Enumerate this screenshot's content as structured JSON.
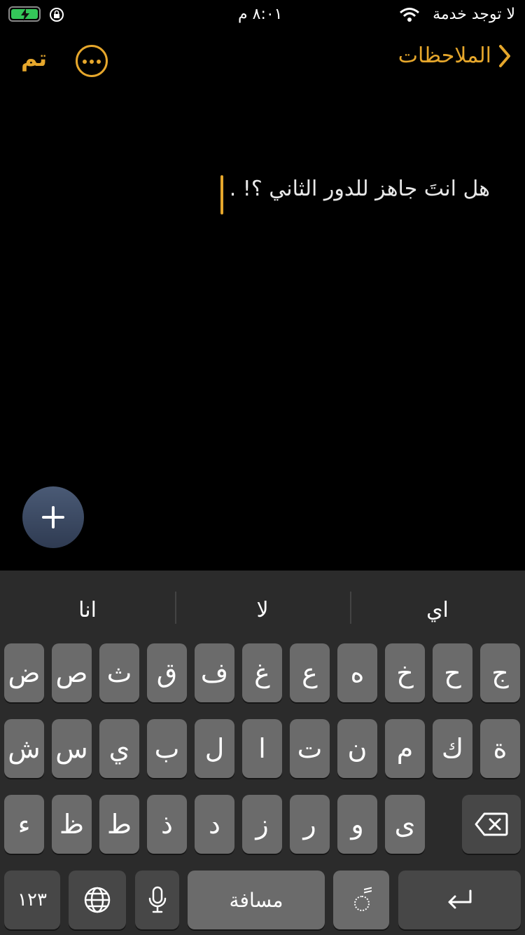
{
  "status_bar": {
    "time": "٨:٠١ م",
    "carrier": "لا توجد خدمة"
  },
  "nav": {
    "done_label": "تم",
    "back_label": "الملاحظات"
  },
  "note": {
    "text": "هل انتَ جاهز للدور الثاني ؟! ."
  },
  "keyboard": {
    "suggestions": [
      "انا",
      "لا",
      "اي"
    ],
    "row1": [
      "ض",
      "ص",
      "ث",
      "ق",
      "ف",
      "غ",
      "ع",
      "ه",
      "خ",
      "ح",
      "ج"
    ],
    "row2": [
      "ش",
      "س",
      "ي",
      "ب",
      "ل",
      "ا",
      "ت",
      "ن",
      "م",
      "ك",
      "ة"
    ],
    "row3": [
      "ء",
      "ظ",
      "ط",
      "ذ",
      "د",
      "ز",
      "ر",
      "و",
      "ى"
    ],
    "numbers_label": "١٢٣",
    "space_label": "مسافة",
    "diacritic_label": "ً"
  },
  "colors": {
    "accent": "#e6a72c",
    "key": "#6b6b6b",
    "key_dark": "#474747",
    "keyboard_bg": "#2b2b2b"
  }
}
